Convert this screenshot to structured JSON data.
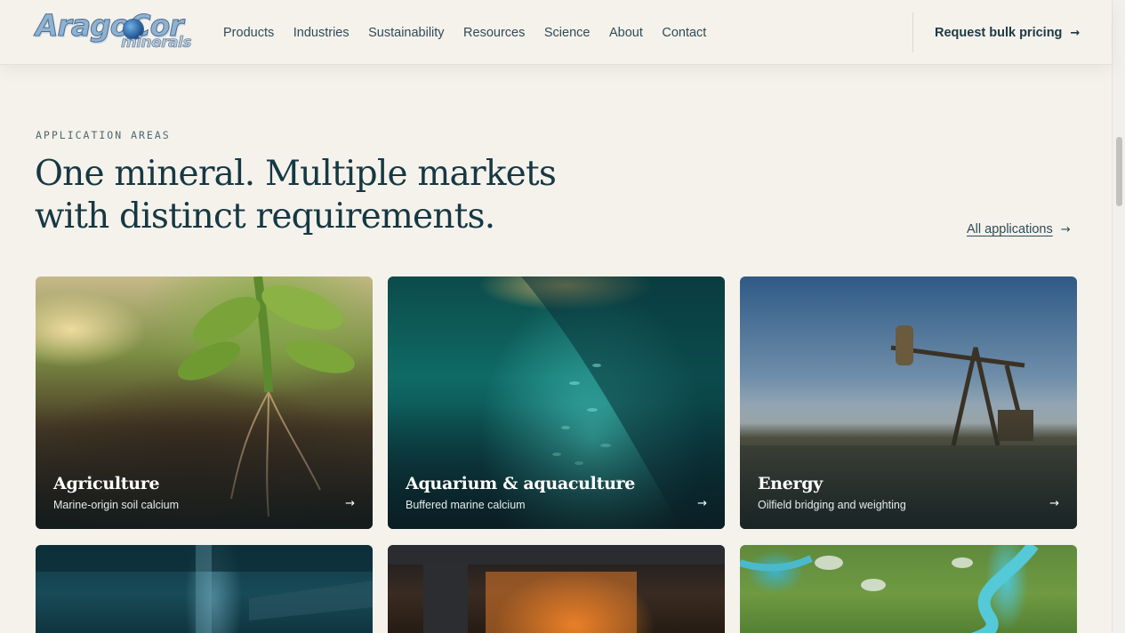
{
  "header": {
    "logo_main": "AragoCor",
    "logo_sub": "minerals",
    "nav": [
      "Products",
      "Industries",
      "Sustainability",
      "Resources",
      "Science",
      "About",
      "Contact"
    ],
    "cta_label": "Request bulk pricing"
  },
  "section": {
    "eyebrow": "APPLICATION AREAS",
    "headline_line1": "One mineral. Multiple markets",
    "headline_line2": "with distinct requirements.",
    "all_link": "All applications"
  },
  "cards": [
    {
      "title": "Agriculture",
      "desc": "Marine-origin soil calcium"
    },
    {
      "title": "Aquarium & aquaculture",
      "desc": "Buffered marine calcium"
    },
    {
      "title": "Energy",
      "desc": "Oilfield bridging and weighting"
    }
  ],
  "icons": {
    "arrow": "→",
    "arrow_icon_name": "arrow-right-icon"
  },
  "colors": {
    "page_bg": "#f5f2ec",
    "heading": "#163843",
    "text": "#2f4b57"
  }
}
